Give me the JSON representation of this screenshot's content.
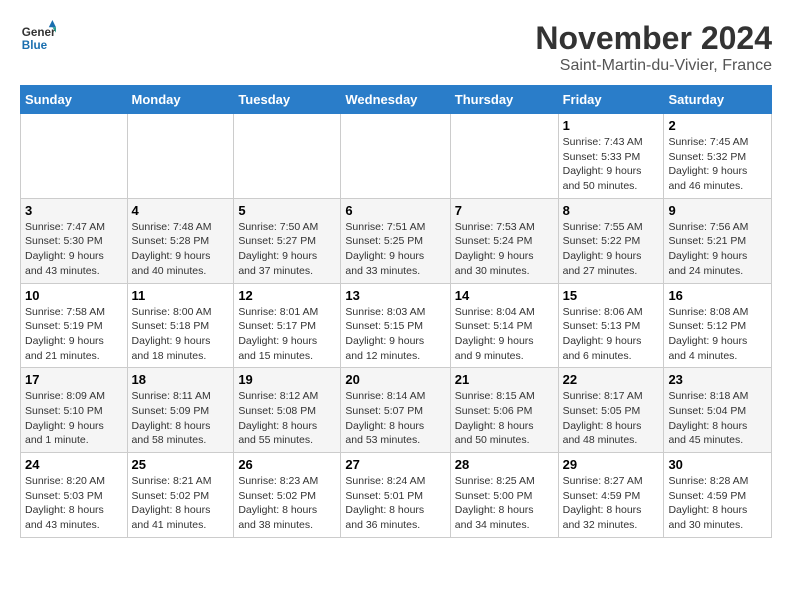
{
  "logo": {
    "line1": "General",
    "line2": "Blue"
  },
  "header": {
    "month": "November 2024",
    "location": "Saint-Martin-du-Vivier, France"
  },
  "weekdays": [
    "Sunday",
    "Monday",
    "Tuesday",
    "Wednesday",
    "Thursday",
    "Friday",
    "Saturday"
  ],
  "weeks": [
    [
      {
        "day": "",
        "info": ""
      },
      {
        "day": "",
        "info": ""
      },
      {
        "day": "",
        "info": ""
      },
      {
        "day": "",
        "info": ""
      },
      {
        "day": "",
        "info": ""
      },
      {
        "day": "1",
        "info": "Sunrise: 7:43 AM\nSunset: 5:33 PM\nDaylight: 9 hours\nand 50 minutes."
      },
      {
        "day": "2",
        "info": "Sunrise: 7:45 AM\nSunset: 5:32 PM\nDaylight: 9 hours\nand 46 minutes."
      }
    ],
    [
      {
        "day": "3",
        "info": "Sunrise: 7:47 AM\nSunset: 5:30 PM\nDaylight: 9 hours\nand 43 minutes."
      },
      {
        "day": "4",
        "info": "Sunrise: 7:48 AM\nSunset: 5:28 PM\nDaylight: 9 hours\nand 40 minutes."
      },
      {
        "day": "5",
        "info": "Sunrise: 7:50 AM\nSunset: 5:27 PM\nDaylight: 9 hours\nand 37 minutes."
      },
      {
        "day": "6",
        "info": "Sunrise: 7:51 AM\nSunset: 5:25 PM\nDaylight: 9 hours\nand 33 minutes."
      },
      {
        "day": "7",
        "info": "Sunrise: 7:53 AM\nSunset: 5:24 PM\nDaylight: 9 hours\nand 30 minutes."
      },
      {
        "day": "8",
        "info": "Sunrise: 7:55 AM\nSunset: 5:22 PM\nDaylight: 9 hours\nand 27 minutes."
      },
      {
        "day": "9",
        "info": "Sunrise: 7:56 AM\nSunset: 5:21 PM\nDaylight: 9 hours\nand 24 minutes."
      }
    ],
    [
      {
        "day": "10",
        "info": "Sunrise: 7:58 AM\nSunset: 5:19 PM\nDaylight: 9 hours\nand 21 minutes."
      },
      {
        "day": "11",
        "info": "Sunrise: 8:00 AM\nSunset: 5:18 PM\nDaylight: 9 hours\nand 18 minutes."
      },
      {
        "day": "12",
        "info": "Sunrise: 8:01 AM\nSunset: 5:17 PM\nDaylight: 9 hours\nand 15 minutes."
      },
      {
        "day": "13",
        "info": "Sunrise: 8:03 AM\nSunset: 5:15 PM\nDaylight: 9 hours\nand 12 minutes."
      },
      {
        "day": "14",
        "info": "Sunrise: 8:04 AM\nSunset: 5:14 PM\nDaylight: 9 hours\nand 9 minutes."
      },
      {
        "day": "15",
        "info": "Sunrise: 8:06 AM\nSunset: 5:13 PM\nDaylight: 9 hours\nand 6 minutes."
      },
      {
        "day": "16",
        "info": "Sunrise: 8:08 AM\nSunset: 5:12 PM\nDaylight: 9 hours\nand 4 minutes."
      }
    ],
    [
      {
        "day": "17",
        "info": "Sunrise: 8:09 AM\nSunset: 5:10 PM\nDaylight: 9 hours\nand 1 minute."
      },
      {
        "day": "18",
        "info": "Sunrise: 8:11 AM\nSunset: 5:09 PM\nDaylight: 8 hours\nand 58 minutes."
      },
      {
        "day": "19",
        "info": "Sunrise: 8:12 AM\nSunset: 5:08 PM\nDaylight: 8 hours\nand 55 minutes."
      },
      {
        "day": "20",
        "info": "Sunrise: 8:14 AM\nSunset: 5:07 PM\nDaylight: 8 hours\nand 53 minutes."
      },
      {
        "day": "21",
        "info": "Sunrise: 8:15 AM\nSunset: 5:06 PM\nDaylight: 8 hours\nand 50 minutes."
      },
      {
        "day": "22",
        "info": "Sunrise: 8:17 AM\nSunset: 5:05 PM\nDaylight: 8 hours\nand 48 minutes."
      },
      {
        "day": "23",
        "info": "Sunrise: 8:18 AM\nSunset: 5:04 PM\nDaylight: 8 hours\nand 45 minutes."
      }
    ],
    [
      {
        "day": "24",
        "info": "Sunrise: 8:20 AM\nSunset: 5:03 PM\nDaylight: 8 hours\nand 43 minutes."
      },
      {
        "day": "25",
        "info": "Sunrise: 8:21 AM\nSunset: 5:02 PM\nDaylight: 8 hours\nand 41 minutes."
      },
      {
        "day": "26",
        "info": "Sunrise: 8:23 AM\nSunset: 5:02 PM\nDaylight: 8 hours\nand 38 minutes."
      },
      {
        "day": "27",
        "info": "Sunrise: 8:24 AM\nSunset: 5:01 PM\nDaylight: 8 hours\nand 36 minutes."
      },
      {
        "day": "28",
        "info": "Sunrise: 8:25 AM\nSunset: 5:00 PM\nDaylight: 8 hours\nand 34 minutes."
      },
      {
        "day": "29",
        "info": "Sunrise: 8:27 AM\nSunset: 4:59 PM\nDaylight: 8 hours\nand 32 minutes."
      },
      {
        "day": "30",
        "info": "Sunrise: 8:28 AM\nSunset: 4:59 PM\nDaylight: 8 hours\nand 30 minutes."
      }
    ]
  ]
}
